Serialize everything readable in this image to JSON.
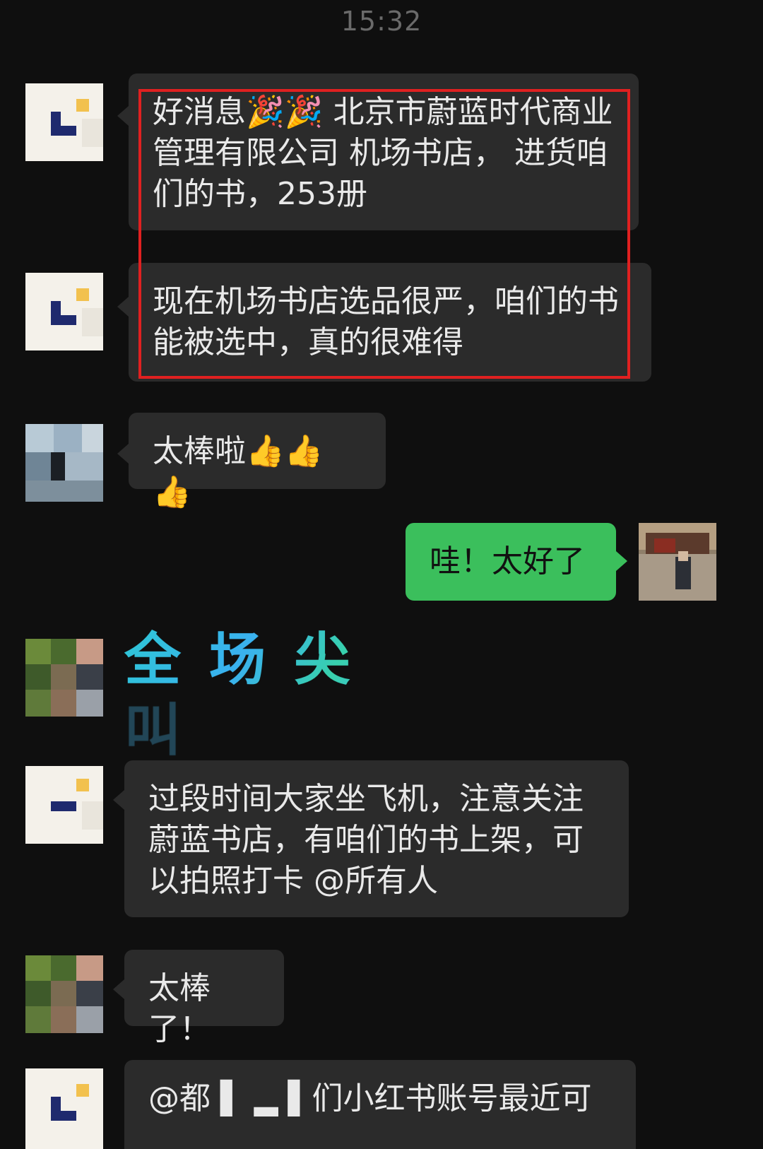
{
  "chat": {
    "timestamp": "15:32",
    "messages": [
      {
        "side": "left",
        "text": "好消息🎉🎉 北京市蔚蓝时代商业管理有限公司 机场书店， 进货咱们的书，253册"
      },
      {
        "side": "left",
        "text": "现在机场书店选品很严，咱们的书能被选中，真的很难得"
      },
      {
        "side": "left",
        "text": "太棒啦👍👍👍"
      },
      {
        "side": "right",
        "text": "哇！太好了"
      },
      {
        "side": "left",
        "type": "sticker",
        "text": "全场尖叫"
      },
      {
        "side": "left",
        "text": "过段时间大家坐飞机，注意关注蔚蓝书店，有咱们的书上架，可以拍照打卡 @所有人"
      },
      {
        "side": "left",
        "text": "太棒了！"
      },
      {
        "side": "left",
        "text": "@都 ▌ ▂ ▌们小红书账号最近可"
      }
    ]
  },
  "colors": {
    "background": "#0f0f0f",
    "bubble_left": "#2b2b2b",
    "bubble_right": "#3bbf5c",
    "highlight": "#e02020"
  }
}
